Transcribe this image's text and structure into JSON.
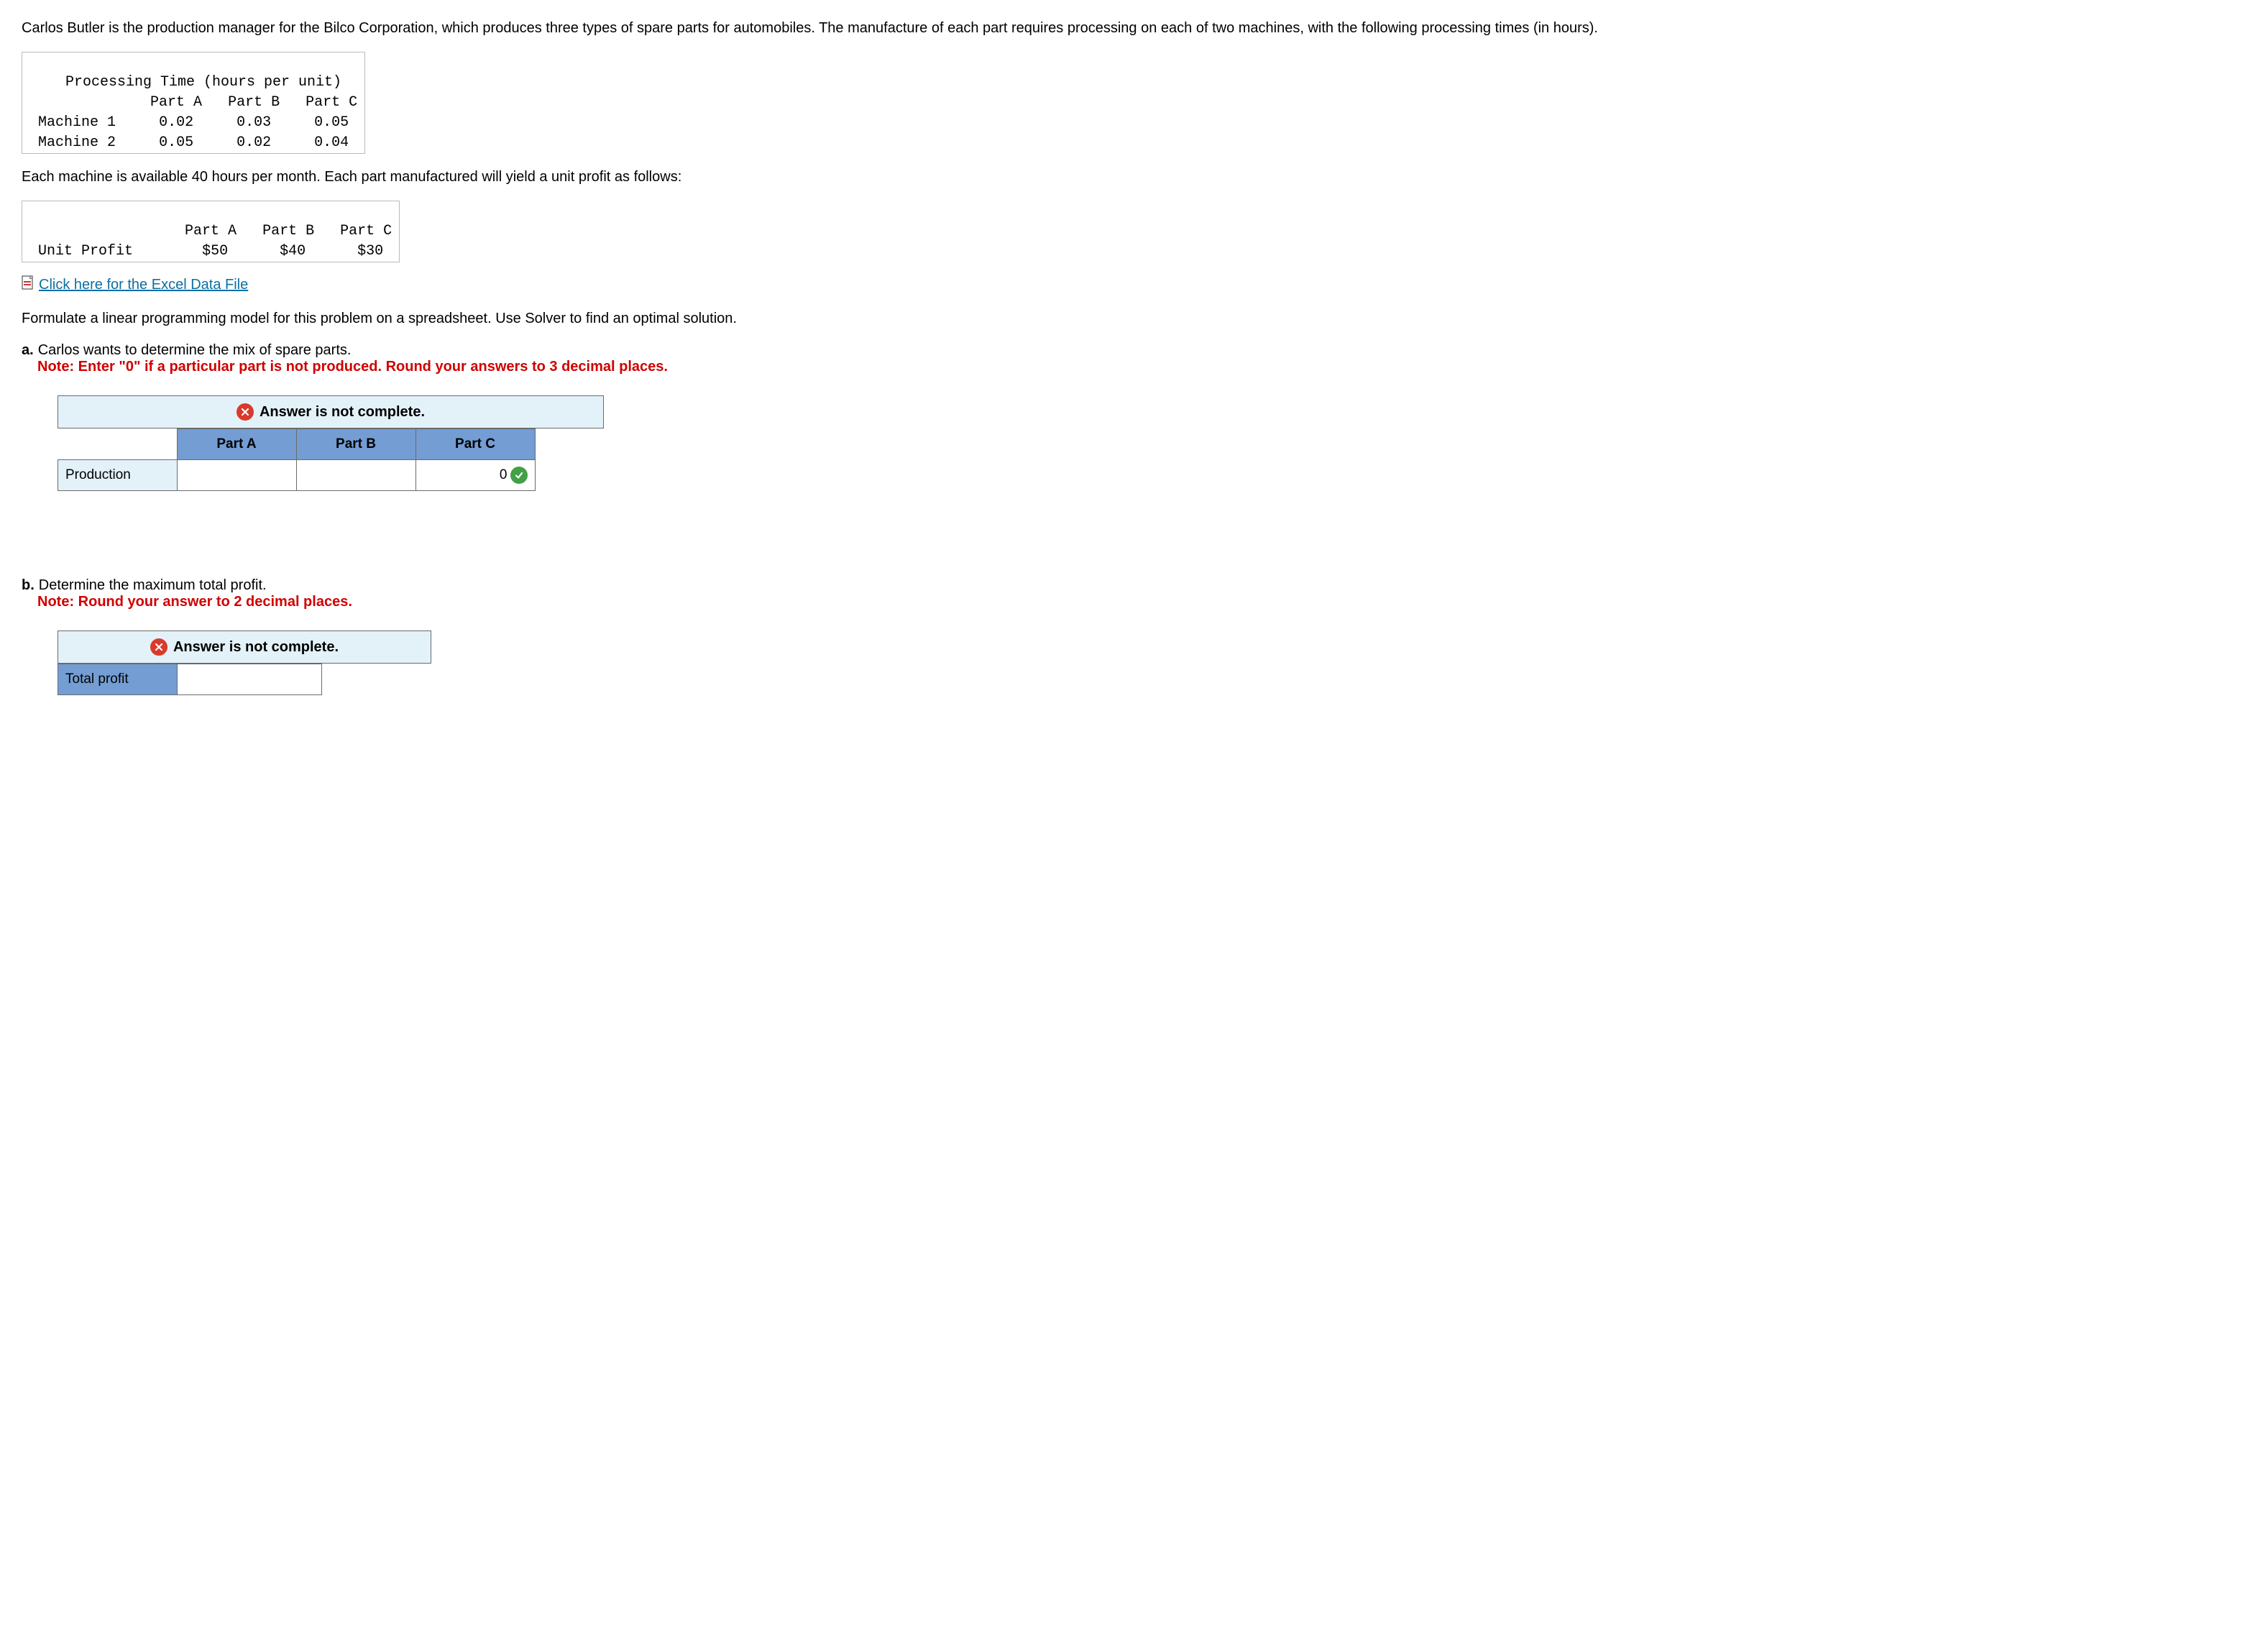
{
  "intro_text": "Carlos Butler is the production manager for the Bilco Corporation, which produces three types of spare parts for automobiles. The manufacture of each part requires processing on each of two machines, with the following processing times (in hours).",
  "processing_table": {
    "title": "Processing Time (hours per unit)",
    "col_a": "Part A",
    "col_b": "Part B",
    "col_c": "Part C",
    "row1_label": "Machine 1",
    "row1_a": "0.02",
    "row1_b": "0.03",
    "row1_c": "0.05",
    "row2_label": "Machine 2",
    "row2_a": "0.05",
    "row2_b": "0.02",
    "row2_c": "0.04"
  },
  "middle_text": "Each machine is available 40 hours per month. Each part manufactured will yield a unit profit as follows:",
  "profit_table": {
    "col_a": "Part A",
    "col_b": "Part B",
    "col_c": "Part C",
    "row_label": "Unit Profit",
    "a": "$50",
    "b": "$40",
    "c": "$30"
  },
  "excel_link_text": "Click here for the Excel Data File",
  "formulate_text": "Formulate a linear programming model for this problem on a spreadsheet. Use Solver to find an optimal solution.",
  "qa": {
    "letter": "a.",
    "text": "Carlos wants to determine the mix of spare parts.",
    "note": "Note: Enter \"0\" if a particular part is not produced. Round your answers to 3 decimal places."
  },
  "banner_text": "Answer is not complete.",
  "grid_a": {
    "h1": "Part A",
    "h2": "Part B",
    "h3": "Part C",
    "rowlabel": "Production",
    "val_a": "",
    "val_b": "",
    "val_c": "0"
  },
  "qb": {
    "letter": "b.",
    "text": "Determine the maximum total profit.",
    "note": "Note: Round your answer to 2 decimal places."
  },
  "grid_b": {
    "rowlabel": "Total profit",
    "val": ""
  }
}
